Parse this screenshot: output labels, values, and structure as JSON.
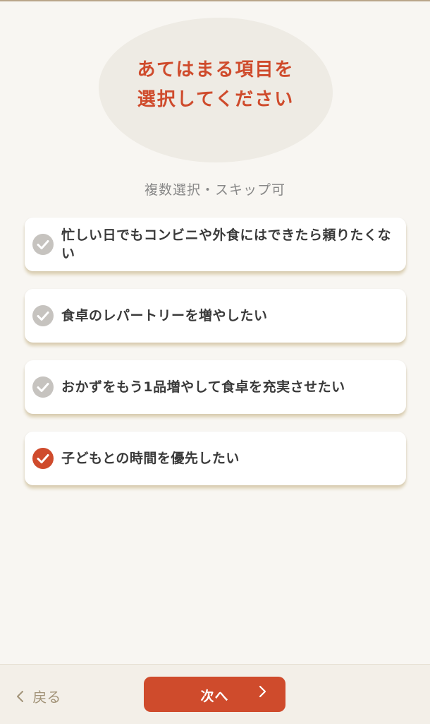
{
  "header": {
    "title_line1": "あてはまる項目を",
    "title_line2": "選択してください",
    "subtitle": "複数選択・スキップ可"
  },
  "options": [
    {
      "label": "忙しい日でもコンビニや外食にはできたら頼りたくない",
      "selected": false
    },
    {
      "label": "食卓のレパートリーを増やしたい",
      "selected": false
    },
    {
      "label": "おかずをもう1品増やして食卓を充実させたい",
      "selected": false
    },
    {
      "label": "子どもとの時間を優先したい",
      "selected": true
    }
  ],
  "footer": {
    "back_label": "戻る",
    "next_label": "次へ"
  },
  "colors": {
    "accent": "#cf4b2c",
    "unchecked": "#c6c3bf",
    "background": "#f8f6f2"
  },
  "icons": {
    "check": "check-circle-icon",
    "back": "chevron-left-icon",
    "next": "chevron-right-icon"
  }
}
